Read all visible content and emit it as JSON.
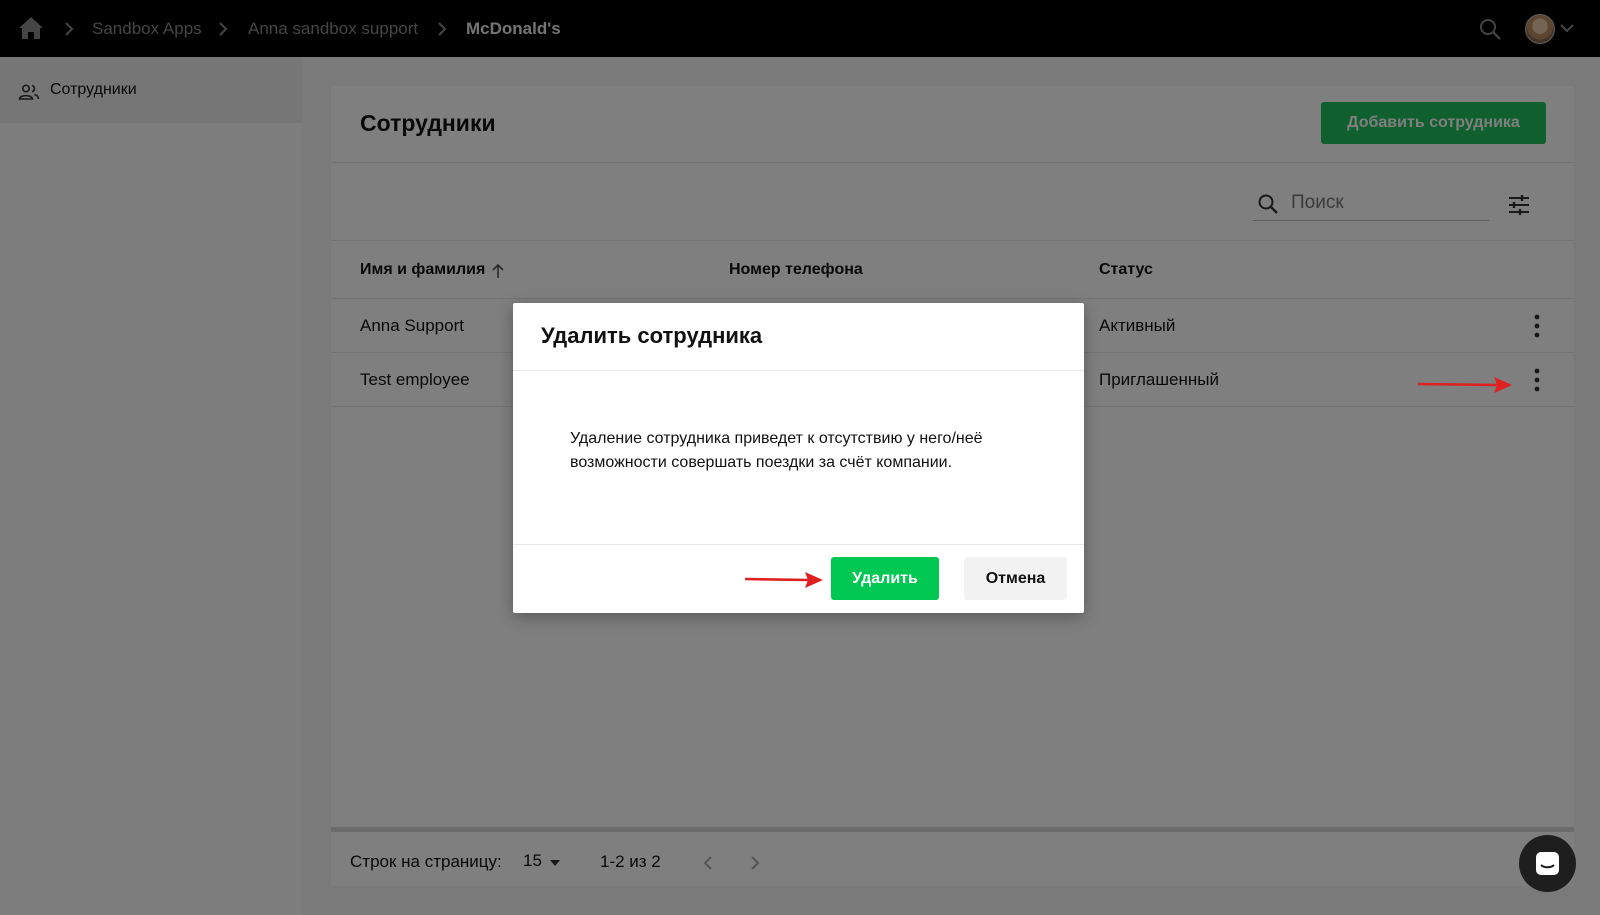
{
  "breadcrumb": {
    "items": [
      "Sandbox Apps",
      "Anna sandbox support"
    ],
    "current": "McDonald's"
  },
  "sidebar": {
    "items": [
      {
        "label": "Сотрудники",
        "icon": "people-icon",
        "active": true
      }
    ]
  },
  "page": {
    "title": "Сотрудники",
    "add_button": "Добавить сотрудника",
    "search_placeholder": "Поиск"
  },
  "table": {
    "columns": [
      "Имя и фамилия",
      "Номер телефона",
      "Статус"
    ],
    "rows": [
      {
        "name": "Anna Support",
        "phone": "",
        "status": "Активный"
      },
      {
        "name": "Test employee",
        "phone": "",
        "status": "Приглашенный"
      }
    ]
  },
  "pagination": {
    "rows_per_page_label": "Строк на страницу:",
    "rows_per_page_value": "15",
    "range": "1-2 из 2"
  },
  "dialog": {
    "title": "Удалить сотрудника",
    "body": "Удаление сотрудника приведет к отсутствию у него/неё возможности совершать поездки за счёт компании.",
    "confirm_label": "Удалить",
    "cancel_label": "Отмена"
  },
  "colors": {
    "accent": "#1fc05c",
    "confirm": "#00c853",
    "annotation_arrow": "#e02020",
    "topbar": "#000000"
  }
}
